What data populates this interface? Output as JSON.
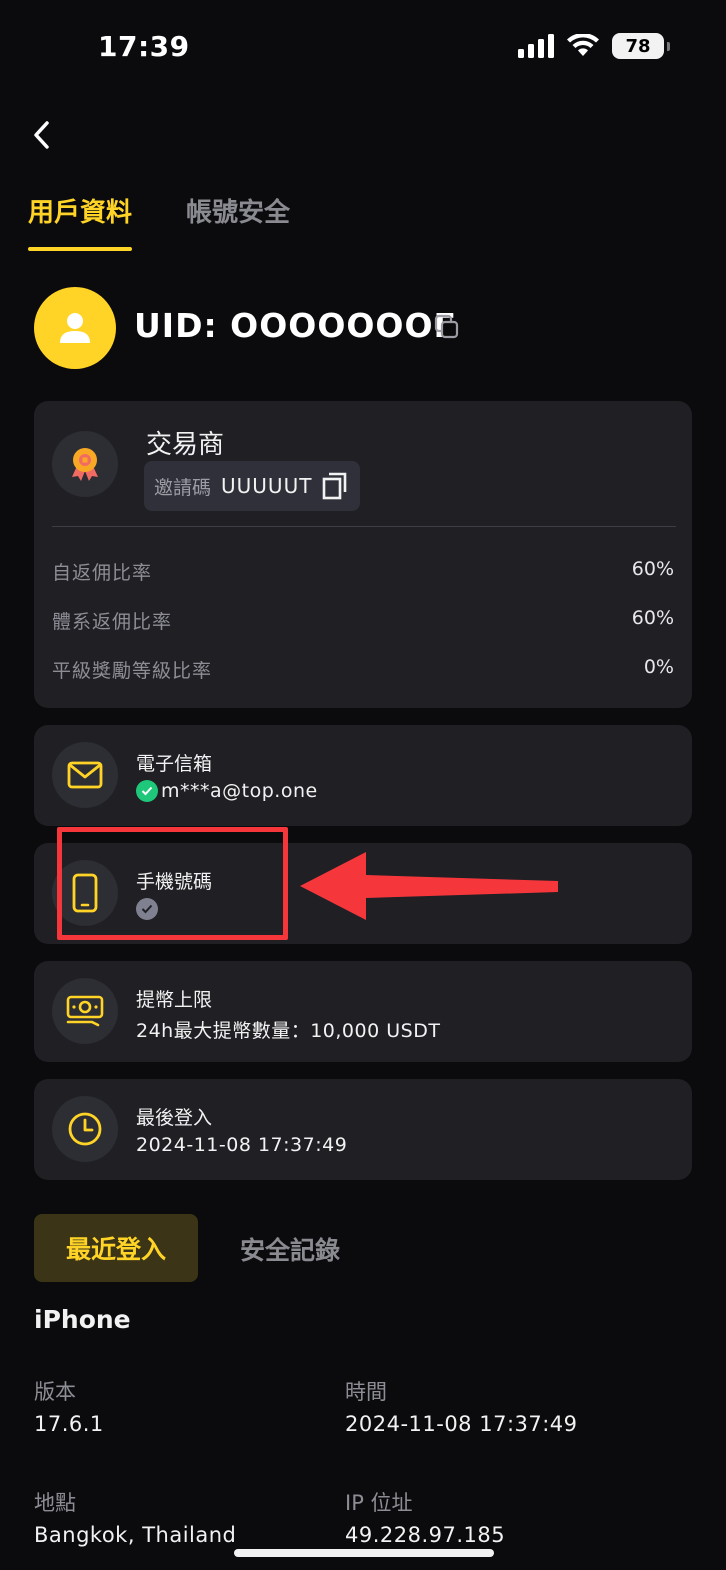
{
  "status_bar": {
    "time": "17:39",
    "battery": "78"
  },
  "tabs": [
    {
      "label": "用戶資料"
    },
    {
      "label": "帳號安全"
    }
  ],
  "profile": {
    "uid": "UID: OOOOOOOE"
  },
  "trader": {
    "title": "交易商",
    "invite_label": "邀請碼",
    "invite_code": "UUUUUT",
    "rates": [
      {
        "label": "自返佣比率",
        "value": "60%"
      },
      {
        "label": "體系返佣比率",
        "value": "60%"
      },
      {
        "label": "平級獎勵等級比率",
        "value": "0%"
      }
    ]
  },
  "email": {
    "title": "電子信箱",
    "value": "m***a@top.one"
  },
  "phone": {
    "title": "手機號碼",
    "value": ""
  },
  "withdraw": {
    "title": "提幣上限",
    "value": "24h最大提幣數量：10,000 USDT"
  },
  "last_login": {
    "title": "最後登入",
    "value": "2024-11-08 17:37:49"
  },
  "login_tabs": {
    "recent": "最近登入",
    "security": "安全記錄"
  },
  "device": {
    "name": "iPhone",
    "version_label": "版本",
    "version": "17.6.1",
    "time_label": "時間",
    "time": "2024-11-08 17:37:49",
    "location_label": "地點",
    "location": "Bangkok, Thailand",
    "ip_label": "IP 位址",
    "ip": "49.228.97.185"
  },
  "colors": {
    "accent": "#ffd426",
    "card": "#1f1f24",
    "annotation": "#f5373c",
    "verified": "#1ec77a"
  }
}
